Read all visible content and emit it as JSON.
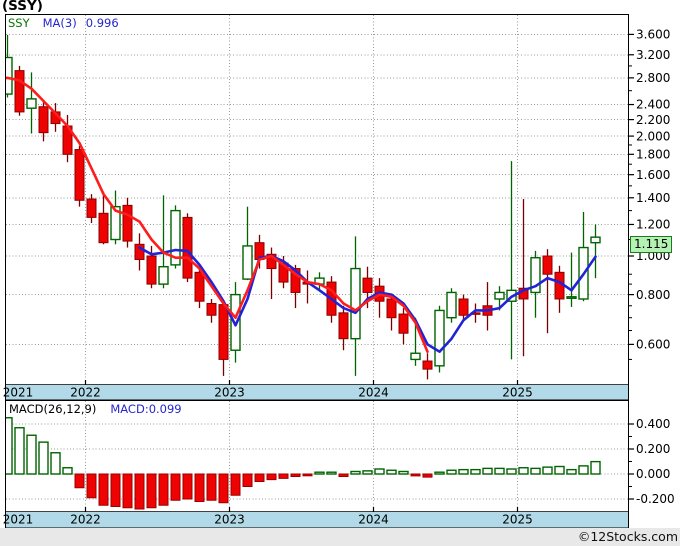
{
  "title": "(SSY)",
  "legend": {
    "symbol": "SSY",
    "ma_label": "MA(3)",
    "ma_value": "0.996"
  },
  "macd_panel": {
    "label": "MACD(26,12,9)",
    "value": "MACD:0.099"
  },
  "price_tag": "1.115",
  "copyright": "©12Stocks.com",
  "colors": {
    "candle_up": "#006400",
    "candle_down": "#ee0202",
    "down_wick": "#7a0000",
    "ma_red": "#ff1c1c",
    "ma_blue": "#2222d6",
    "grid": "#9c9c9c",
    "band_blue": "#b2d9e7",
    "tag_green": "#b4f2b4",
    "footer_gray": "#e8e8e8"
  },
  "chart_data": {
    "type": "candlestick",
    "symbol": "SSY",
    "interval": "monthly",
    "title": "(SSY)",
    "price_axis": {
      "scale": "log",
      "labeled_ticks": [
        3.6,
        3.2,
        2.8,
        2.4,
        2.2,
        2.0,
        1.8,
        1.6,
        1.4,
        1.2,
        1.0,
        0.8,
        0.6
      ],
      "minor_ticks": [
        3.0,
        2.6,
        1.9,
        1.7,
        1.5,
        1.3,
        1.1,
        0.9,
        0.85,
        0.75,
        0.7,
        0.65,
        0.55
      ],
      "last_price": 1.115
    },
    "x_axis": {
      "year_labels": [
        "2021",
        "2022",
        "2023",
        "2024",
        "2025"
      ],
      "year_start_indices": [
        0,
        7,
        19,
        31,
        43
      ]
    },
    "months": [
      "2021-06",
      "2021-07",
      "2021-08",
      "2021-09",
      "2021-10",
      "2021-11",
      "2021-12",
      "2022-01",
      "2022-02",
      "2022-03",
      "2022-04",
      "2022-05",
      "2022-06",
      "2022-07",
      "2022-08",
      "2022-09",
      "2022-10",
      "2022-11",
      "2022-12",
      "2023-01",
      "2023-02",
      "2023-03",
      "2023-04",
      "2023-05",
      "2023-06",
      "2023-07",
      "2023-08",
      "2023-09",
      "2023-10",
      "2023-11",
      "2023-12",
      "2024-01",
      "2024-02",
      "2024-03",
      "2024-04",
      "2024-05",
      "2024-06",
      "2024-07",
      "2024-08",
      "2024-09",
      "2024-10",
      "2024-11",
      "2024-12",
      "2025-01",
      "2025-02",
      "2025-03",
      "2025-04",
      "2025-05",
      "2025-06",
      "2025-07"
    ],
    "candles": [
      [
        2.55,
        3.59,
        2.5,
        3.15
      ],
      [
        2.92,
        3.0,
        2.25,
        2.3
      ],
      [
        2.35,
        2.89,
        2.03,
        2.48
      ],
      [
        2.37,
        2.45,
        1.94,
        2.04
      ],
      [
        2.3,
        2.42,
        2.05,
        2.15
      ],
      [
        2.12,
        2.26,
        1.72,
        1.8
      ],
      [
        1.85,
        1.89,
        1.33,
        1.38
      ],
      [
        1.39,
        1.43,
        1.21,
        1.25
      ],
      [
        1.28,
        1.45,
        1.07,
        1.08
      ],
      [
        1.1,
        1.46,
        1.07,
        1.33
      ],
      [
        1.34,
        1.4,
        1.05,
        1.09
      ],
      [
        1.07,
        1.14,
        0.92,
        0.98
      ],
      [
        1.0,
        1.06,
        0.83,
        0.85
      ],
      [
        0.85,
        1.42,
        0.83,
        0.94
      ],
      [
        0.95,
        1.34,
        0.93,
        1.3
      ],
      [
        1.25,
        1.28,
        0.86,
        0.88
      ],
      [
        0.91,
        0.94,
        0.74,
        0.77
      ],
      [
        0.76,
        0.78,
        0.68,
        0.71
      ],
      [
        0.755,
        0.77,
        0.5,
        0.55
      ],
      [
        0.58,
        0.86,
        0.54,
        0.8
      ],
      [
        0.875,
        1.33,
        0.87,
        1.06
      ],
      [
        1.08,
        1.13,
        0.93,
        0.98
      ],
      [
        1.01,
        1.05,
        0.78,
        0.93
      ],
      [
        0.96,
        1.0,
        0.83,
        0.86
      ],
      [
        0.93,
        0.95,
        0.74,
        0.81
      ],
      [
        0.86,
        0.92,
        0.76,
        0.85
      ],
      [
        0.85,
        0.91,
        0.82,
        0.88
      ],
      [
        0.86,
        0.89,
        0.68,
        0.71
      ],
      [
        0.72,
        0.75,
        0.58,
        0.62
      ],
      [
        0.62,
        1.12,
        0.5,
        0.93
      ],
      [
        0.88,
        0.94,
        0.74,
        0.81
      ],
      [
        0.84,
        0.88,
        0.7,
        0.77
      ],
      [
        0.78,
        0.8,
        0.65,
        0.7
      ],
      [
        0.715,
        0.74,
        0.6,
        0.64
      ],
      [
        0.55,
        0.7,
        0.53,
        0.57
      ],
      [
        0.545,
        0.57,
        0.49,
        0.52
      ],
      [
        0.53,
        0.75,
        0.51,
        0.73
      ],
      [
        0.7,
        0.83,
        0.68,
        0.81
      ],
      [
        0.78,
        0.8,
        0.685,
        0.71
      ],
      [
        0.72,
        0.76,
        0.68,
        0.715
      ],
      [
        0.75,
        0.86,
        0.65,
        0.71
      ],
      [
        0.78,
        0.84,
        0.73,
        0.81
      ],
      [
        0.77,
        1.73,
        0.55,
        0.82
      ],
      [
        0.83,
        1.39,
        0.56,
        0.78
      ],
      [
        0.81,
        1.03,
        0.7,
        0.99
      ],
      [
        1.0,
        1.04,
        0.64,
        0.9
      ],
      [
        0.91,
        0.945,
        0.72,
        0.78
      ],
      [
        0.785,
        1.02,
        0.745,
        0.79
      ],
      [
        0.78,
        1.29,
        0.77,
        1.05
      ],
      [
        1.08,
        1.2,
        0.88,
        1.115
      ]
    ],
    "ma_red_points": [
      [
        0,
        2.8
      ],
      [
        1,
        2.76
      ],
      [
        2,
        2.63
      ],
      [
        3,
        2.45
      ],
      [
        4,
        2.28
      ],
      [
        5,
        2.12
      ],
      [
        6,
        1.92
      ],
      [
        7,
        1.66
      ],
      [
        8,
        1.43
      ],
      [
        9,
        1.3
      ],
      [
        10,
        1.27
      ],
      [
        11,
        1.22
      ],
      [
        12,
        1.1
      ],
      [
        13,
        1.02
      ],
      [
        14,
        0.99
      ],
      [
        15,
        0.99
      ],
      [
        16,
        0.93
      ],
      [
        17,
        0.84
      ],
      [
        18,
        0.76
      ],
      [
        19,
        0.7
      ],
      [
        20,
        0.82
      ],
      [
        21,
        0.98
      ],
      [
        22,
        1.0
      ],
      [
        23,
        0.95
      ],
      [
        24,
        0.9
      ],
      [
        25,
        0.86
      ],
      [
        26,
        0.85
      ],
      [
        27,
        0.82
      ],
      [
        28,
        0.76
      ],
      [
        29,
        0.73
      ],
      [
        30,
        0.77
      ],
      [
        31,
        0.8
      ],
      [
        32,
        0.79
      ],
      [
        33,
        0.75
      ],
      [
        34,
        0.68
      ],
      [
        35,
        0.575
      ]
    ],
    "ma_blue_points": [
      [
        11,
        1.05
      ],
      [
        12,
        1.01
      ],
      [
        13,
        1.02
      ],
      [
        14,
        1.035
      ],
      [
        15,
        1.03
      ],
      [
        16,
        0.95
      ],
      [
        17,
        0.86
      ],
      [
        18,
        0.77
      ],
      [
        19,
        0.67
      ],
      [
        20,
        0.78
      ],
      [
        21,
        0.99
      ],
      [
        22,
        1.0
      ],
      [
        23,
        0.97
      ],
      [
        24,
        0.92
      ],
      [
        25,
        0.86
      ],
      [
        26,
        0.82
      ],
      [
        27,
        0.78
      ],
      [
        28,
        0.74
      ],
      [
        29,
        0.72
      ],
      [
        30,
        0.78
      ],
      [
        31,
        0.81
      ],
      [
        32,
        0.8
      ],
      [
        33,
        0.76
      ],
      [
        34,
        0.69
      ],
      [
        35,
        0.6
      ],
      [
        36,
        0.575
      ],
      [
        37,
        0.62
      ],
      [
        38,
        0.69
      ],
      [
        39,
        0.73
      ],
      [
        40,
        0.73
      ],
      [
        41,
        0.74
      ],
      [
        42,
        0.79
      ],
      [
        43,
        0.82
      ],
      [
        44,
        0.84
      ],
      [
        45,
        0.88
      ],
      [
        46,
        0.86
      ],
      [
        47,
        0.82
      ],
      [
        48,
        0.9
      ],
      [
        49,
        0.996
      ]
    ],
    "macd": {
      "type": "bar",
      "params": "(26,12,9)",
      "last_value": 0.099,
      "axis_ticks": [
        0.4,
        0.2,
        0.0,
        -0.2
      ],
      "axis_minor_ticks": [
        0.3,
        0.1,
        -0.1
      ],
      "values": [
        0.45,
        0.37,
        0.31,
        0.255,
        0.17,
        0.05,
        -0.11,
        -0.19,
        -0.25,
        -0.26,
        -0.27,
        -0.28,
        -0.27,
        -0.25,
        -0.21,
        -0.2,
        -0.22,
        -0.21,
        -0.23,
        -0.17,
        -0.1,
        -0.06,
        -0.045,
        -0.035,
        -0.02,
        -0.01,
        0.01,
        0.01,
        -0.02,
        0.02,
        0.025,
        0.04,
        0.03,
        0.02,
        -0.015,
        -0.025,
        0.01,
        0.03,
        0.035,
        0.035,
        0.045,
        0.045,
        0.04,
        0.05,
        0.045,
        0.055,
        0.06,
        0.035,
        0.065,
        0.099
      ]
    }
  }
}
